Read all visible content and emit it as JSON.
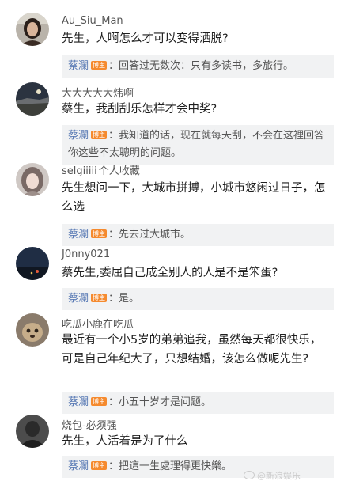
{
  "comments": [
    {
      "user": "Au_Siu_Man",
      "tag": "",
      "text": "先生，人啊怎么才可以变得洒脱?",
      "reply_author": "蔡瀾",
      "reply_badge": "博主",
      "reply_text": "：回答过无数次：只有多读书，多旅行。"
    },
    {
      "user": "大大大大大炜啊",
      "tag": "",
      "text": "蔡生，我刮刮乐怎样才会中奖?",
      "reply_author": "蔡瀾",
      "reply_badge": "博主",
      "reply_text": "：我知道的话，现在就每天刮，不会在这裡回答你这些不太聰明的问题。"
    },
    {
      "user": "selgiiiii",
      "tag": "个人收藏",
      "text": "先生想问一下，大城市拼搏，小城市悠闲过日子，怎么选",
      "reply_author": "蔡瀾",
      "reply_badge": "博主",
      "reply_text": "：先去过大城市。"
    },
    {
      "user": "J0nny021",
      "tag": "",
      "text": "蔡先生,委屈自己成全别人的人是不是笨蛋?",
      "reply_author": "蔡瀾",
      "reply_badge": "博主",
      "reply_text": "：是。"
    },
    {
      "user": "吃瓜小鹿在吃瓜",
      "tag": "",
      "text": "最近有一个小5岁的弟弟追我，虽然每天都很快乐，可是自己年纪大了，只想结婚，该怎么做呢先生?",
      "reply_author": "蔡瀾",
      "reply_badge": "博主",
      "reply_text": "：小五十岁才是问题。"
    },
    {
      "user": "烧包-必须强",
      "tag": "",
      "text": "先生，人活着是为了什么",
      "reply_author": "蔡瀾",
      "reply_badge": "博主",
      "reply_text": "：把這一生處理得更快樂。"
    }
  ],
  "watermark": "@新浪娱乐",
  "colors": {
    "reply_author": "#5a7bb5",
    "badge": "#f58a2e",
    "reply_bg": "#f1f2f3"
  }
}
